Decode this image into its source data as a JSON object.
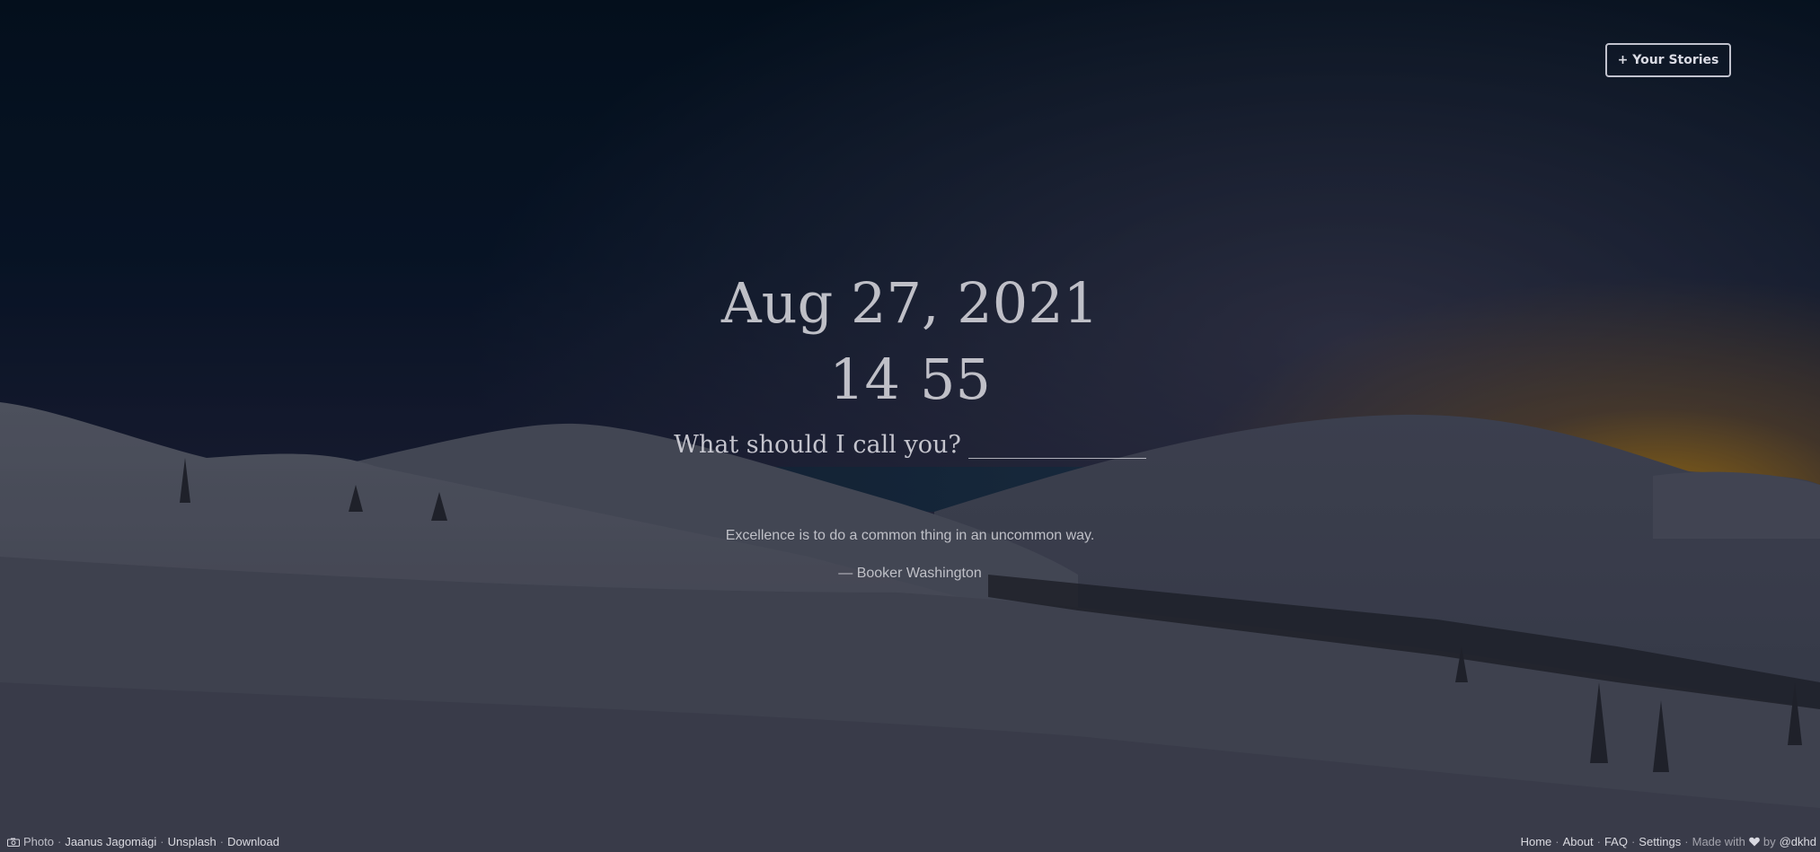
{
  "header": {
    "stories_button": "+ Your Stories"
  },
  "clock": {
    "date": "Aug 27, 2021",
    "hours": "14",
    "minutes": "55"
  },
  "greeting": {
    "prompt": "What should I call you?",
    "input_value": "",
    "input_placeholder": ""
  },
  "quote": {
    "text": "Excellence is to do a common thing in an uncommon way.",
    "author": "— Booker Washington"
  },
  "footer_left": {
    "icon": "camera-icon",
    "photo_label": "Photo",
    "photographer": "Jaanus Jagomägi",
    "source": "Unsplash",
    "download": "Download",
    "separator": "·"
  },
  "footer_right": {
    "home": "Home",
    "about": "About",
    "faq": "FAQ",
    "settings": "Settings",
    "made_with": "Made with",
    "heart_icon": "heart-icon",
    "by": "by",
    "author_handle": "@dkhd",
    "separator": "·"
  },
  "colors": {
    "sky_top": "#061628",
    "horizon_glow": "#d6961a",
    "snow": "#5d6170"
  }
}
